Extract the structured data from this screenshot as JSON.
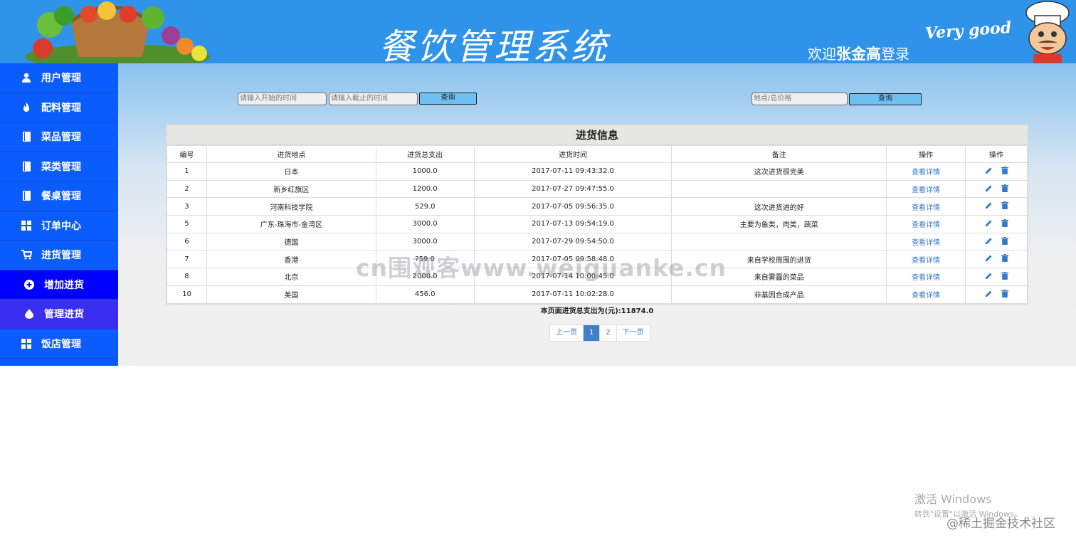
{
  "header": {
    "title": "餐饮管理系统",
    "welcome_prefix": "欢迎",
    "user": "张金高",
    "welcome_suffix": "登录",
    "slogan": "Very good"
  },
  "sidebar": {
    "items": [
      {
        "label": "用户管理",
        "icon": "user-icon"
      },
      {
        "label": "配料管理",
        "icon": "fire-icon"
      },
      {
        "label": "菜品管理",
        "icon": "book-icon"
      },
      {
        "label": "菜类管理",
        "icon": "book-icon"
      },
      {
        "label": "餐桌管理",
        "icon": "book-icon"
      },
      {
        "label": "订单中心",
        "icon": "grid-icon"
      },
      {
        "label": "进货管理",
        "icon": "cart-icon"
      },
      {
        "label": "增加进货",
        "icon": "plus-circle-icon"
      },
      {
        "label": "管理进货",
        "icon": "drop-icon"
      },
      {
        "label": "饭店管理",
        "icon": "grid-icon"
      }
    ]
  },
  "search": {
    "start_placeholder": "请输入开始的时间",
    "end_placeholder": "请输入截止的时间",
    "query_label": "查询",
    "keyword_placeholder": "地点/总价格",
    "query2_label": "查询"
  },
  "table": {
    "title": "进货信息",
    "columns": [
      "编号",
      "进货地点",
      "进货总支出",
      "进货时间",
      "备注",
      "操作",
      "操作"
    ],
    "rows": [
      {
        "id": "1",
        "place": "日本",
        "total": "1000.0",
        "time": "2017-07-11 09:43:32.0",
        "note": "这次进货很完美",
        "detail": "查看详情"
      },
      {
        "id": "2",
        "place": "新乡红旗区",
        "total": "1200.0",
        "time": "2017-07-27 09:47:55.0",
        "note": "",
        "detail": "查看详情"
      },
      {
        "id": "3",
        "place": "河南科技学院",
        "total": "529.0",
        "time": "2017-07-05 09:56:35.0",
        "note": "这次进货进的好",
        "detail": "查看详情"
      },
      {
        "id": "5",
        "place": "广东-珠海市-金湾区",
        "total": "3000.0",
        "time": "2017-07-13 09:54:19.0",
        "note": "主要为鱼类，肉类，蔬菜",
        "detail": "查看详情"
      },
      {
        "id": "6",
        "place": "德国",
        "total": "3000.0",
        "time": "2017-07-29 09:54:50.0",
        "note": "",
        "detail": "查看详情"
      },
      {
        "id": "7",
        "place": "香港",
        "total": "?59.0",
        "time": "2017-07-05 09:58:48.0",
        "note": "来自学校周围的进货",
        "detail": "查看详情"
      },
      {
        "id": "8",
        "place": "北京",
        "total": "2000.0",
        "time": "2017-07-14 10:00:45.0",
        "note": "来自雾霾的菜品",
        "detail": "查看详情"
      },
      {
        "id": "10",
        "place": "美国",
        "total": "456.0",
        "time": "2017-07-11 10:02:28.0",
        "note": "非基因合成产品",
        "detail": "查看详情"
      }
    ]
  },
  "summary": "本页面进货总支出为(元):11874.0",
  "pagination": {
    "prev": "上一页",
    "pages": [
      "1",
      "2"
    ],
    "current": "1",
    "next": "下一页"
  },
  "overlay": {
    "watermark": "cn围观客www.weiguanke.cn",
    "windows_line1": "激活 Windows",
    "windows_line2": "转到\"设置\"以激活 Windows。",
    "credit": "@稀土掘金技术社区"
  },
  "colors": {
    "header": "#2f93ea",
    "sidebar": "#0b5cfc",
    "link": "#3478c8",
    "button": "#6dc0f2"
  }
}
